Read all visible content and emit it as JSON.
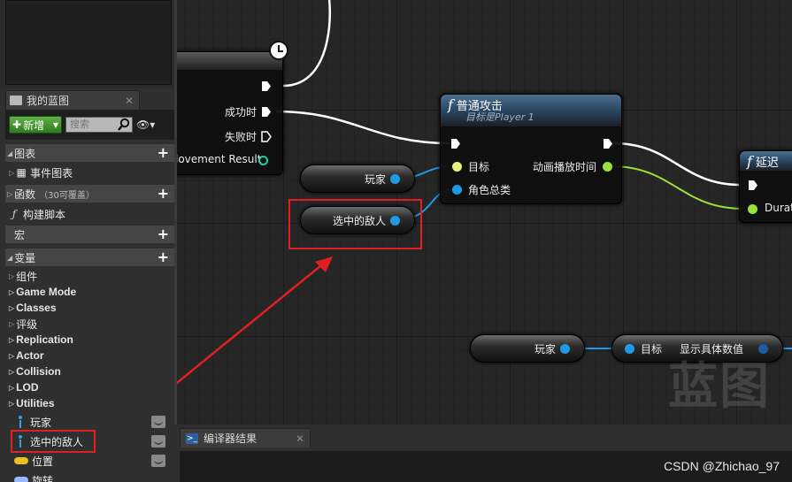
{
  "blueprint_panel": {
    "tab_title": "我的蓝图",
    "new_button_label": "新增",
    "search_placeholder": "搜索",
    "sections": {
      "graphs": "图表",
      "event_graph": "事件图表",
      "functions": "函数",
      "functions_hint": "（30可覆盖）",
      "construction_script": "构建脚本",
      "macros": "宏",
      "variables": "变量"
    },
    "categories": [
      "组件",
      "Game Mode",
      "Classes",
      "评级",
      "Replication",
      "Actor",
      "Collision",
      "LOD",
      "Utilities"
    ],
    "variables": [
      {
        "name": "玩家",
        "type_color": "#3aa0e6"
      },
      {
        "name": "选中的敌人",
        "type_color": "#3aa0e6"
      },
      {
        "name": "位置",
        "type_color": "#e8c020"
      },
      {
        "name": "旋转",
        "type_color": "#9cb8ff"
      }
    ]
  },
  "graph": {
    "left_node": {
      "pins": {
        "success": "成功时",
        "failure": "失败时",
        "result": "lovement Result"
      }
    },
    "attack_node": {
      "title": "普通攻击",
      "subtitle": "目标是Player 1",
      "target_pin": "目标",
      "anim_pin": "动画播放时间",
      "role_pin": "角色总类"
    },
    "delay_node": {
      "title": "延迟",
      "duration_pin": "Durat"
    },
    "var_nodes": {
      "player_top": "玩家",
      "selected_enemy": "选中的敌人",
      "player_bottom": "玩家"
    },
    "display_node": {
      "target_pin": "目标",
      "title": "显示具体数值"
    },
    "watermark": "蓝图"
  },
  "bottom_panel": {
    "tab_title": "编译器结果"
  },
  "credit": "CSDN @Zhichao_97",
  "colors": {
    "exec_wire": "#ffffff",
    "object_wire": "#1f9ae8",
    "float_wire": "#9be03a",
    "highlight": "#e02020"
  }
}
